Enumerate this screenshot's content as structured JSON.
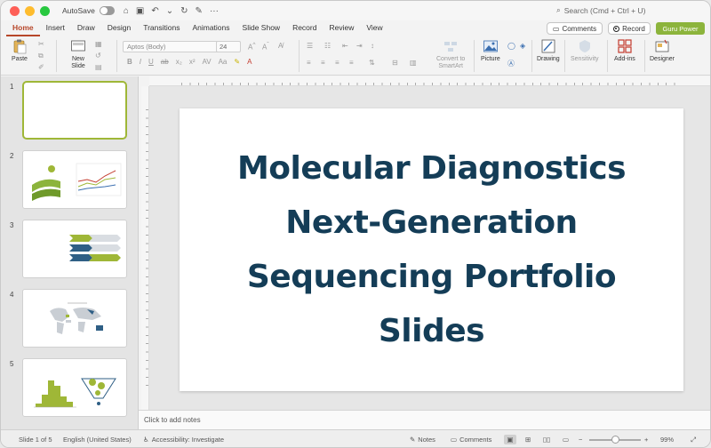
{
  "titlebar": {
    "autosave_label": "AutoSave",
    "search_placeholder": "Search (Cmd + Ctrl + U)"
  },
  "tabs": [
    "Home",
    "Insert",
    "Draw",
    "Design",
    "Transitions",
    "Animations",
    "Slide Show",
    "Record",
    "Review",
    "View"
  ],
  "actions": {
    "comments": "Comments",
    "record": "Record",
    "guru": "Guru Power"
  },
  "ribbon": {
    "paste": "Paste",
    "new_slide": "New\nSlide",
    "font_name": "Aptos (Body)",
    "font_size": "24",
    "convert_smartart": "Convert to\nSmartArt",
    "picture": "Picture",
    "drawing": "Drawing",
    "sensitivity": "Sensitivity",
    "addins": "Add-ins",
    "designer": "Designer"
  },
  "slides": [
    {
      "number": "1"
    },
    {
      "number": "2"
    },
    {
      "number": "3"
    },
    {
      "number": "4"
    },
    {
      "number": "5"
    }
  ],
  "main_slide": {
    "title_lines": [
      "Molecular Diagnostics",
      "Next-Generation",
      "Sequencing Portfolio",
      "Slides"
    ]
  },
  "notes": {
    "placeholder": "Click to add notes"
  },
  "status": {
    "slide_indicator": "Slide 1 of 5",
    "language": "English (United States)",
    "accessibility": "Accessibility: Investigate",
    "notes": "Notes",
    "comments": "Comments",
    "zoom": "99%"
  },
  "colors": {
    "accent_tab": "#b7472a",
    "title_navy": "#143d57",
    "lime": "#9fb737",
    "guru_green": "#8cb43c"
  }
}
